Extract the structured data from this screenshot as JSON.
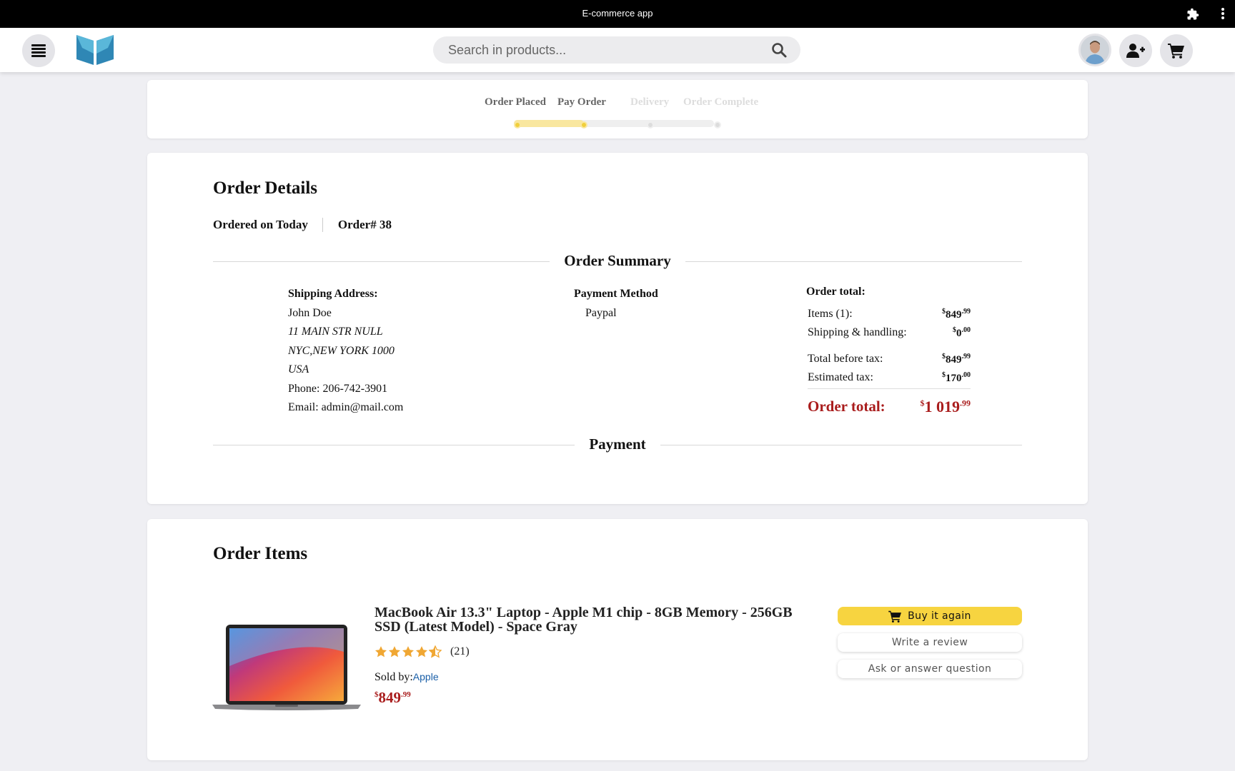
{
  "window": {
    "title": "E-commerce app"
  },
  "header": {
    "search_placeholder": "Search in products..."
  },
  "steps": [
    {
      "label": "Order Placed",
      "done": true
    },
    {
      "label": "Pay Order",
      "done": true
    },
    {
      "label": "Delivery",
      "done": false
    },
    {
      "label": "Order Complete",
      "done": false
    }
  ],
  "order": {
    "title": "Order Details",
    "ordered_on": "Ordered on Today",
    "order_number": "Order# 38",
    "summary_title": "Order Summary",
    "payment_title": "Payment",
    "shipping": {
      "heading": "Shipping Address:",
      "name": "John Doe",
      "street": "11 MAIN STR NULL",
      "city": "NYC,NEW YORK 1000",
      "country": "USA",
      "phone": "Phone: 206-742-3901",
      "email": "Email: admin@mail.com"
    },
    "payment_method": {
      "heading": "Payment Method",
      "value": "Paypal"
    },
    "totals": {
      "heading": "Order total:",
      "items_label": "Items (1):",
      "items_whole": "849",
      "items_cents": "99",
      "shipping_label": "Shipping & handling:",
      "shipping_whole": "0",
      "shipping_cents": "00",
      "before_tax_label": "Total before tax:",
      "before_tax_whole": "849",
      "before_tax_cents": "99",
      "tax_label": "Estimated tax:",
      "tax_whole": "170",
      "tax_cents": "00",
      "grand_label": "Order total:",
      "grand_whole": "1 019",
      "grand_cents": "99",
      "currency": "$"
    }
  },
  "items": {
    "title": "Order Items",
    "list": [
      {
        "name": "MacBook Air 13.3\" Laptop - Apple M1 chip - 8GB Memory - 256GB SSD (Latest Model) - Space Gray",
        "rating": 4.5,
        "review_count": "(21)",
        "sold_by_label": "Sold by:",
        "seller": "Apple",
        "price_whole": "849",
        "price_cents": "99",
        "currency": "$",
        "buy_again_label": "Buy it again",
        "review_label": "Write a review",
        "ask_label": "Ask or answer question"
      }
    ]
  },
  "colors": {
    "accent": "#f7d440",
    "price_red": "#a91c1c",
    "step_done": "#f0cf3c",
    "link_blue": "#1a5fa8"
  }
}
